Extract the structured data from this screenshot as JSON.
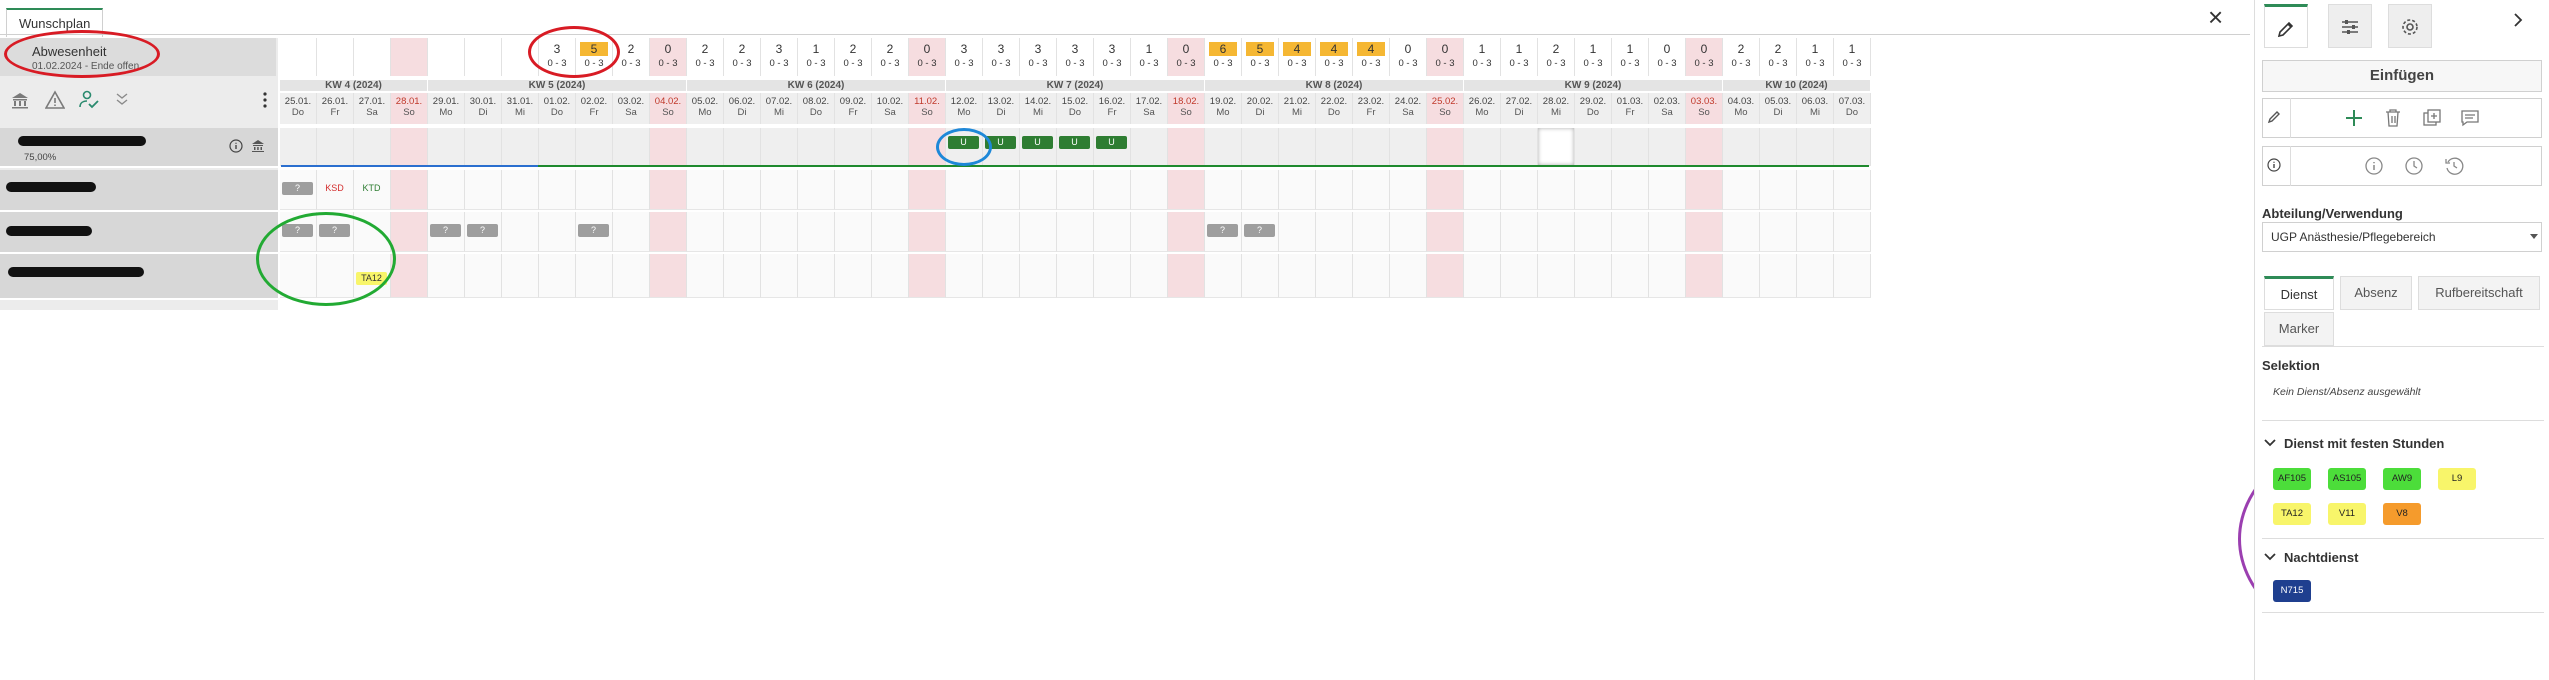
{
  "tab_title": "Wunschplan",
  "absence": {
    "title": "Abwesenheit",
    "subtitle": "01.02.2024 - Ende offen"
  },
  "counts": [
    {
      "n": "",
      "r": ""
    },
    {
      "n": "",
      "r": ""
    },
    {
      "n": "",
      "r": ""
    },
    {
      "n": "",
      "r": ""
    },
    {
      "n": "",
      "r": ""
    },
    {
      "n": "",
      "r": ""
    },
    {
      "n": "",
      "r": ""
    },
    {
      "n": "3",
      "r": "0 - 3"
    },
    {
      "n": "5",
      "r": "0 - 3",
      "hl": "#f5b733"
    },
    {
      "n": "2",
      "r": "0 - 3"
    },
    {
      "n": "0",
      "r": "0 - 3"
    },
    {
      "n": "2",
      "r": "0 - 3"
    },
    {
      "n": "2",
      "r": "0 - 3"
    },
    {
      "n": "3",
      "r": "0 - 3"
    },
    {
      "n": "1",
      "r": "0 - 3"
    },
    {
      "n": "2",
      "r": "0 - 3"
    },
    {
      "n": "2",
      "r": "0 - 3"
    },
    {
      "n": "0",
      "r": "0 - 3"
    },
    {
      "n": "3",
      "r": "0 - 3"
    },
    {
      "n": "3",
      "r": "0 - 3"
    },
    {
      "n": "3",
      "r": "0 - 3"
    },
    {
      "n": "3",
      "r": "0 - 3"
    },
    {
      "n": "3",
      "r": "0 - 3"
    },
    {
      "n": "1",
      "r": "0 - 3"
    },
    {
      "n": "0",
      "r": "0 - 3"
    },
    {
      "n": "6",
      "r": "0 - 3",
      "hl": "#f5b733"
    },
    {
      "n": "5",
      "r": "0 - 3",
      "hl": "#f5b733"
    },
    {
      "n": "4",
      "r": "0 - 3",
      "hl": "#f5b733"
    },
    {
      "n": "4",
      "r": "0 - 3",
      "hl": "#f5b733"
    },
    {
      "n": "4",
      "r": "0 - 3",
      "hl": "#f5b733"
    },
    {
      "n": "0",
      "r": "0 - 3"
    },
    {
      "n": "0",
      "r": "0 - 3"
    },
    {
      "n": "1",
      "r": "0 - 3"
    },
    {
      "n": "1",
      "r": "0 - 3"
    },
    {
      "n": "2",
      "r": "0 - 3"
    },
    {
      "n": "1",
      "r": "0 - 3"
    },
    {
      "n": "1",
      "r": "0 - 3"
    },
    {
      "n": "0",
      "r": "0 - 3"
    },
    {
      "n": "0",
      "r": "0 - 3"
    },
    {
      "n": "2",
      "r": "0 - 3"
    },
    {
      "n": "2",
      "r": "0 - 3"
    },
    {
      "n": "1",
      "r": "0 - 3"
    },
    {
      "n": "1",
      "r": "0 - 3"
    }
  ],
  "weeks": [
    {
      "label": "KW 4 (2024)",
      "start": 0,
      "span": 4
    },
    {
      "label": "KW 5 (2024)",
      "start": 4,
      "span": 7
    },
    {
      "label": "KW 6 (2024)",
      "start": 11,
      "span": 7
    },
    {
      "label": "KW 7 (2024)",
      "start": 18,
      "span": 7
    },
    {
      "label": "KW 8 (2024)",
      "start": 25,
      "span": 7
    },
    {
      "label": "KW 9 (2024)",
      "start": 32,
      "span": 7
    },
    {
      "label": "KW 10 (2024)",
      "start": 39,
      "span": 4
    }
  ],
  "days": [
    {
      "d": "25.01.",
      "w": "Do"
    },
    {
      "d": "26.01.",
      "w": "Fr"
    },
    {
      "d": "27.01.",
      "w": "Sa"
    },
    {
      "d": "28.01.",
      "w": "So",
      "red": true
    },
    {
      "d": "29.01.",
      "w": "Mo"
    },
    {
      "d": "30.01.",
      "w": "Di"
    },
    {
      "d": "31.01.",
      "w": "Mi"
    },
    {
      "d": "01.02.",
      "w": "Do"
    },
    {
      "d": "02.02.",
      "w": "Fr"
    },
    {
      "d": "03.02.",
      "w": "Sa"
    },
    {
      "d": "04.02.",
      "w": "So",
      "red": true
    },
    {
      "d": "05.02.",
      "w": "Mo"
    },
    {
      "d": "06.02.",
      "w": "Di"
    },
    {
      "d": "07.02.",
      "w": "Mi"
    },
    {
      "d": "08.02.",
      "w": "Do"
    },
    {
      "d": "09.02.",
      "w": "Fr"
    },
    {
      "d": "10.02.",
      "w": "Sa"
    },
    {
      "d": "11.02.",
      "w": "So",
      "red": true
    },
    {
      "d": "12.02.",
      "w": "Mo"
    },
    {
      "d": "13.02.",
      "w": "Di"
    },
    {
      "d": "14.02.",
      "w": "Mi"
    },
    {
      "d": "15.02.",
      "w": "Do"
    },
    {
      "d": "16.02.",
      "w": "Fr"
    },
    {
      "d": "17.02.",
      "w": "Sa"
    },
    {
      "d": "18.02.",
      "w": "So",
      "red": true
    },
    {
      "d": "19.02.",
      "w": "Mo"
    },
    {
      "d": "20.02.",
      "w": "Di"
    },
    {
      "d": "21.02.",
      "w": "Mi"
    },
    {
      "d": "22.02.",
      "w": "Do"
    },
    {
      "d": "23.02.",
      "w": "Fr"
    },
    {
      "d": "24.02.",
      "w": "Sa"
    },
    {
      "d": "25.02.",
      "w": "So",
      "red": true
    },
    {
      "d": "26.02.",
      "w": "Mo"
    },
    {
      "d": "27.02.",
      "w": "Di"
    },
    {
      "d": "28.02.",
      "w": "Mi"
    },
    {
      "d": "29.02.",
      "w": "Do"
    },
    {
      "d": "01.03.",
      "w": "Fr"
    },
    {
      "d": "02.03.",
      "w": "Sa"
    },
    {
      "d": "03.03.",
      "w": "So",
      "red": true
    },
    {
      "d": "04.03.",
      "w": "Mo"
    },
    {
      "d": "05.03.",
      "w": "Di"
    },
    {
      "d": "06.03.",
      "w": "Mi"
    },
    {
      "d": "07.03.",
      "w": "Do"
    }
  ],
  "employee1": {
    "percent": "75,00%"
  },
  "row_tags": {
    "row1_ksd": "KSD",
    "row1_ktd": "KTD",
    "q": "?",
    "ta12": "TA12",
    "u": "U"
  },
  "right_panel": {
    "insert_label": "Einfügen",
    "department_label": "Abteilung/Verwendung",
    "department_value": "UGP Anästhesie/Pflegebereich",
    "subtabs": [
      "Dienst",
      "Absenz",
      "Rufbereitschaft",
      "Marker"
    ],
    "selection_label": "Selektion",
    "selection_text": "Kein Dienst/Absenz ausgewählt",
    "section_fixed": "Dienst mit festen Stunden",
    "section_night": "Nachtdienst",
    "fixed_services": [
      {
        "label": "AF105",
        "color": "#4cdd3a"
      },
      {
        "label": "AS105",
        "color": "#4cdd3a"
      },
      {
        "label": "AW9",
        "color": "#4cdd3a"
      },
      {
        "label": "L9",
        "color": "#f8f56a"
      },
      {
        "label": "TA12",
        "color": "#f8f56a"
      },
      {
        "label": "V11",
        "color": "#f8f56a"
      },
      {
        "label": "V8",
        "color": "#f59b2c"
      }
    ],
    "night_services": [
      {
        "label": "N715",
        "color": "#1f3f8f",
        "text": "#ffffff"
      }
    ]
  },
  "colors": {
    "accent": "#2e8b57",
    "weekend": "#f6dde0",
    "highlight": "#f5b733",
    "annot_red": "#d81b24",
    "annot_green": "#22aa33",
    "annot_blue": "#1e88d8",
    "annot_purple": "#9b3fb0"
  }
}
